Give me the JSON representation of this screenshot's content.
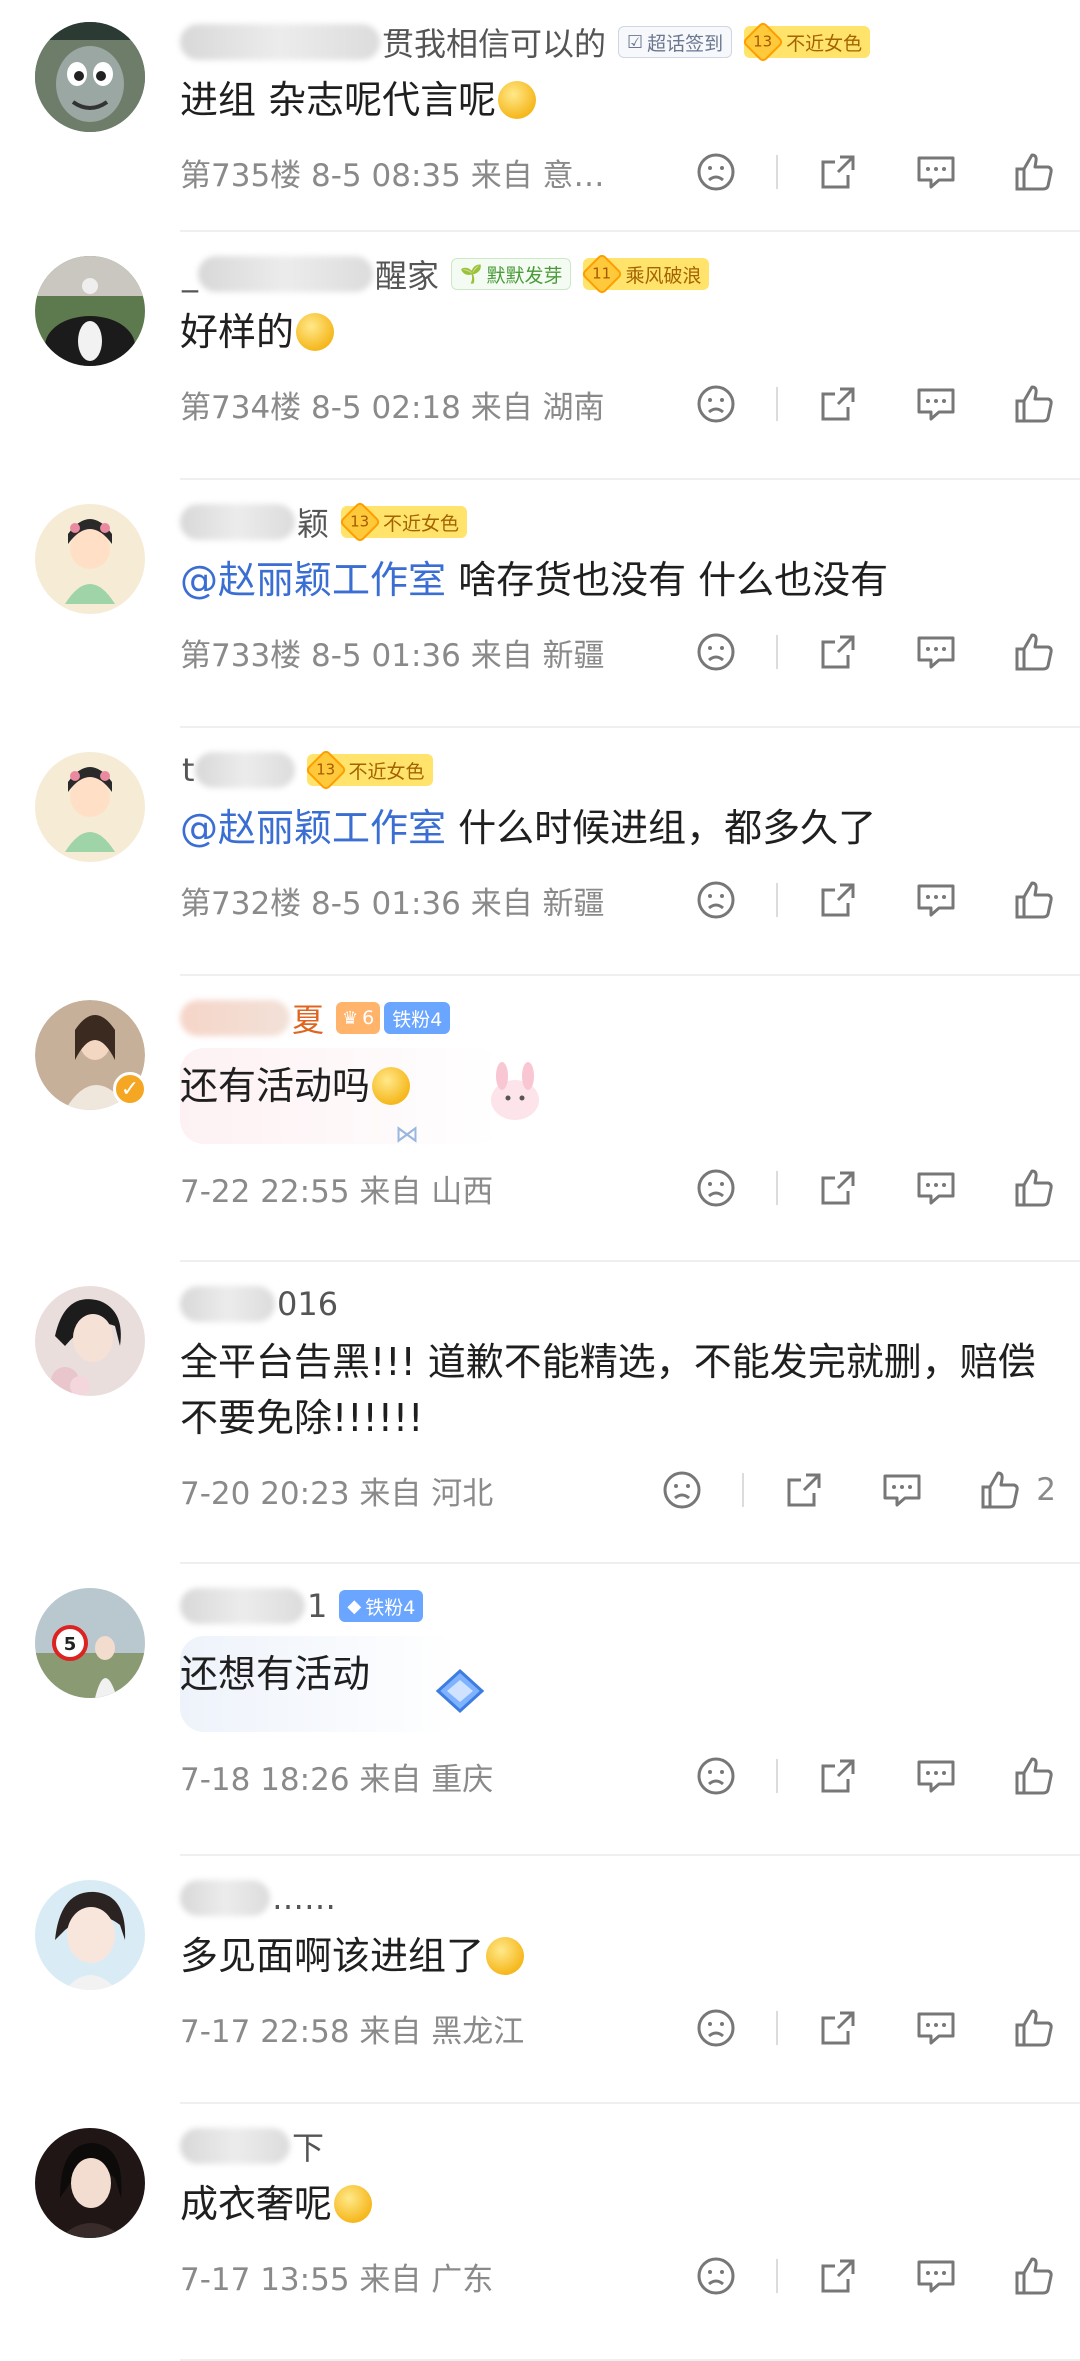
{
  "comments": [
    {
      "name_suffix": "贯我相信可以的",
      "badges": [
        "超话签到",
        "13",
        "不近女色"
      ],
      "text": "进组 杂志呢代言呢",
      "meta": "第735楼 8-5 08:35 来自 意…"
    },
    {
      "name_prefix": "_",
      "name_suffix": "醒家",
      "badges": [
        "默默发芽",
        "11",
        "乘风破浪"
      ],
      "text": "好样的",
      "meta": "第734楼 8-5 02:18 来自 湖南"
    },
    {
      "name_suffix": "颖",
      "badges": [
        "13",
        "不近女色"
      ],
      "mention": "@赵丽颖工作室",
      "text": " 啥存货也没有 什么也没有",
      "meta": "第733楼 8-5 01:36 来自 新疆"
    },
    {
      "name_prefix": "t",
      "badges": [
        "13",
        "不近女色"
      ],
      "mention": "@赵丽颖工作室",
      "text": " 什么时候进组，都多久了",
      "meta": "第732楼 8-5 01:36 来自 新疆"
    },
    {
      "name_suffix": "夏",
      "badges": [
        "6",
        "铁粉4"
      ],
      "text": "还有活动吗",
      "meta": "7-22 22:55 来自 山西"
    },
    {
      "name_suffix": "016",
      "text": "全平台告黑!!! 道歉不能精选，不能发完就删，赔偿不要免除!!!!!!",
      "meta": "7-20 20:23 来自 河北",
      "likes": "2"
    },
    {
      "name_suffix": "1",
      "badges": [
        "铁粉4"
      ],
      "text": "还想有活动",
      "meta": "7-18 18:26 来自 重庆"
    },
    {
      "name_suffix": "……",
      "text": "多见面啊该进组了",
      "meta": "7-17 22:58 来自 黑龙江"
    },
    {
      "name_suffix": "下",
      "text": "成衣奢呢",
      "meta": "7-17 13:55 来自 广东"
    }
  ],
  "icons": {
    "dislike": "frown-icon",
    "share": "share-icon",
    "comment": "comment-icon",
    "like": "thumbs-up-icon"
  },
  "colors": {
    "mention": "#3a6ed3",
    "meta": "#8a8a8a",
    "badge_yellow": "#ffe36b",
    "badge_blue": "#6aa5ff"
  }
}
